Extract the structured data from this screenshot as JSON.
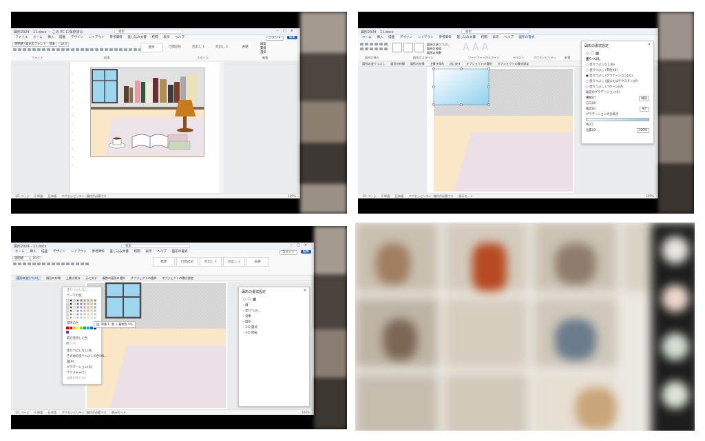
{
  "q1": {
    "doc_title": "図形2024 - 11.docx ・ この PC に保存済み",
    "search": "検索",
    "menu": [
      "ファイル",
      "ホーム",
      "挿入",
      "描画",
      "デザイン",
      "レイアウト",
      "参考資料",
      "差し込み文書",
      "校閲",
      "表示",
      "ヘルプ"
    ],
    "comment": "コメント",
    "edit": "編集",
    "font_name": "游明朝 (本文のフォント - 日本",
    "font_size": "10.5",
    "styles": [
      "標準",
      "行間詰め",
      "見出し 1",
      "見出し 2",
      "表題"
    ],
    "find_items": [
      "検索",
      "置換",
      "選択"
    ],
    "groups": [
      "フォント",
      "段落",
      "スタイル",
      "編集"
    ],
    "status": [
      "1/1 ページ",
      "0 単語",
      "日本語",
      "アクセシビリティ: 検討が必要です"
    ],
    "zoom": "100%"
  },
  "q2": {
    "doc_title": "図形2024 - 11.docx",
    "search": "検索",
    "menu": [
      "ファイル",
      "ホーム",
      "挿入",
      "描画",
      "デザイン",
      "レイアウト",
      "参考資料",
      "差し込み文書",
      "校閲",
      "表示",
      "ヘルプ",
      "図形の書式"
    ],
    "quick": [
      "図形の挿入",
      "図形のスタイル",
      "ワードアートのスタイル",
      "テキスト",
      "アクセシビリティ",
      "配置",
      "サイズ"
    ],
    "quickbar": [
      "図形の塗りつぶし",
      "図形の枠線",
      "図形の効果",
      "上書き保存",
      "元に戻す",
      "オブジェクトの選択",
      "オブジェクトの書式設定"
    ],
    "pane_title": "図形の書式設定",
    "fill_header": "塗りつぶし",
    "fill_options": [
      "塗りつぶしなし(N)",
      "塗りつぶし (単色)(S)",
      "塗りつぶし (グラデーション)(G)",
      "塗りつぶし (図またはテクスチャ)(P)",
      "塗りつぶし (パターン)(A)"
    ],
    "gradient_rows": [
      "既定のグラデーション(R)",
      "種類(Y)",
      "方向(D)",
      "角度(E)",
      "グラデーションの分岐点",
      "色(C)",
      "位置(O)"
    ],
    "type_value": "線形",
    "angle_value": "90°",
    "position_value": "100%",
    "status": [
      "1/1 ページ",
      "0 単語",
      "日本語",
      "アクセシビリティ: 検討が必要です",
      "表示モード"
    ],
    "zoom": "100%"
  },
  "q3": {
    "doc_title": "図形2024 - 11.docx",
    "search": "検索",
    "menu": [
      "ファイル",
      "ホーム",
      "挿入",
      "描画",
      "デザイン",
      "レイアウト",
      "参考資料",
      "差し込み文書",
      "校閲",
      "表示",
      "ヘルプ",
      "図形の書式"
    ],
    "font_name": "游明朝",
    "font_size": "10.5",
    "styles": [
      "標準",
      "行間詰め",
      "見出し 1",
      "見出し 2",
      "表題"
    ],
    "comment": "コメント",
    "edit": "編集",
    "quickbar": [
      "図形の塗りつぶし",
      "図形の枠線",
      "上書き保存",
      "元に戻す",
      "複数の図形の選択",
      "オブジェクトの選択",
      "オブジェクトの書式設定"
    ],
    "dropdown": {
      "auto": "塗りつぶしなし",
      "theme_label": "テーマの色",
      "standard_label": "標準の色",
      "recent_label": "最近使用した色",
      "items": [
        "塗りつぶしなし(N)",
        "その他の塗りつぶしの色(M)...",
        "図(P)...",
        "グラデーション(G)",
        "テクスチャ(T)",
        "画像の塗り(B)"
      ],
      "tooltip": "白, 背景 1, 黒 + 基本色 5%"
    },
    "pane_title": "図形の書式設定",
    "pane_items": [
      "線",
      "塗りつぶし",
      "効果",
      "図形",
      "3-D 書式",
      "3-D 回転"
    ],
    "status": [
      "1/1 ページ",
      "0 単語",
      "日本語",
      "アクセシビリティ: 検討が必要です",
      "表示モード"
    ],
    "zoom": "100%"
  },
  "colors": {
    "word_blue": "#185abd",
    "wall_gray": "#d9d9d9",
    "floor_cream": "#fbe7c8",
    "rug_pink": "#eae0e6",
    "glass_blue": "#9ed5ef",
    "frame_dark": "#4a4a4a"
  }
}
